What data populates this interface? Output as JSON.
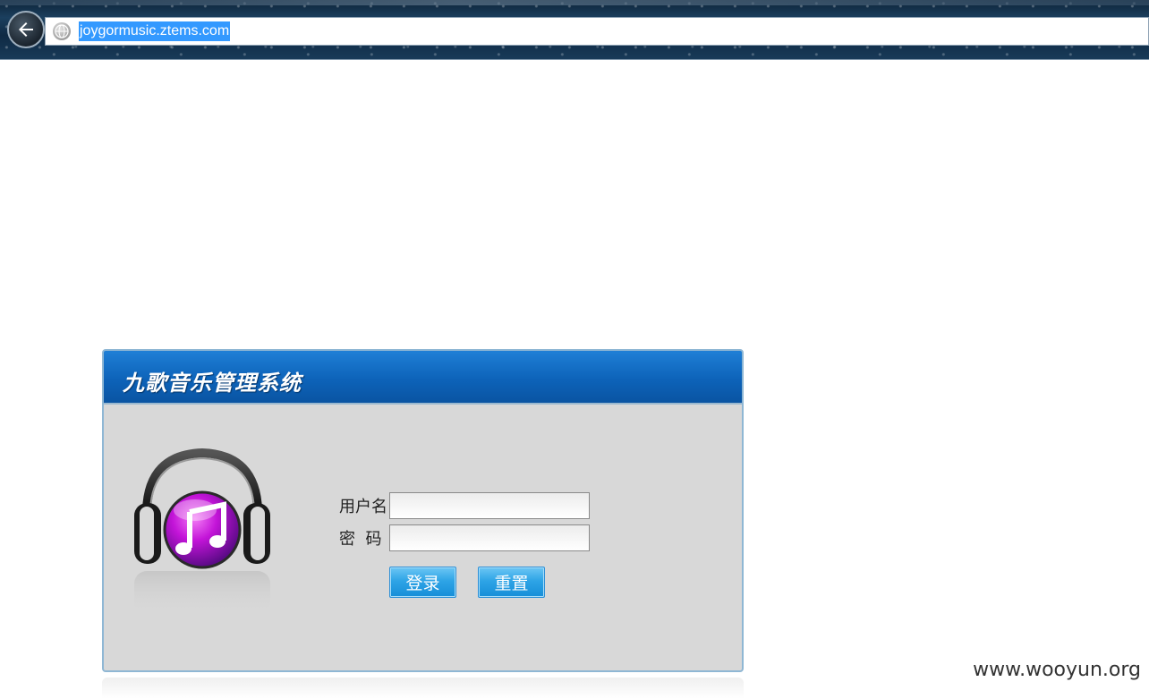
{
  "browser": {
    "url": "joygormusic.ztems.com",
    "back_icon": "arrow-left-icon",
    "site_icon": "globe-icon"
  },
  "login": {
    "title": "九歌音乐管理系统",
    "logo_icon": "headphones-music-icon",
    "username_label": "用户名",
    "username_value": "",
    "password_label": "密  码",
    "password_value": "",
    "login_button": "登录",
    "reset_button": "重置"
  },
  "watermark": "www.wooyun.org",
  "colors": {
    "header_blue": "#0d63b9",
    "panel_bg": "#d8d8d8",
    "button_blue": "#2ea4e6",
    "url_highlight": "#3399ff"
  }
}
